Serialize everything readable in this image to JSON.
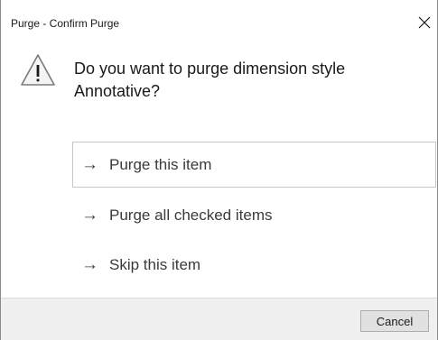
{
  "window": {
    "title": "Purge - Confirm Purge",
    "close_icon": "close-icon"
  },
  "message": {
    "icon": "warning-icon",
    "text": "Do you want to purge dimension style Annotative?"
  },
  "commands": [
    {
      "arrow": "→",
      "label": "Purge this item",
      "selected": true
    },
    {
      "arrow": "→",
      "label": "Purge all checked items",
      "selected": false
    },
    {
      "arrow": "→",
      "label": "Skip this item",
      "selected": false
    }
  ],
  "footer": {
    "cancel_label": "Cancel"
  },
  "colors": {
    "footer_bg": "#f0f0f0",
    "button_bg": "#e1e1e1",
    "selected_border": "#c6c6c6"
  }
}
